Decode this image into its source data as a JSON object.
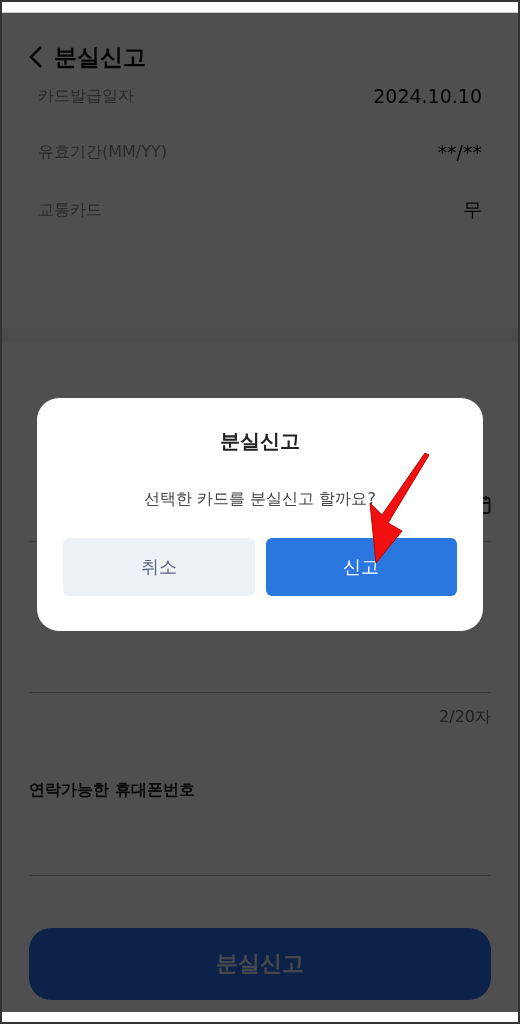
{
  "header": {
    "title": "분실신고"
  },
  "card_info": [
    {
      "label": "카드발급일자",
      "value": "2024.10.10"
    },
    {
      "label": "유효기간(MM/YY)",
      "value": "**/**"
    },
    {
      "label": "교통카드",
      "value": "무"
    }
  ],
  "form": {
    "memo_counter": "2/20자",
    "phone_label": "연락가능한 휴대폰번호",
    "submit_button": "분실신고"
  },
  "dialog": {
    "title": "분실신고",
    "message": "선택한 카드를 분실신고 할까요?",
    "buttons": [
      {
        "label": "취소",
        "kind": "secondary"
      },
      {
        "label": "신고",
        "kind": "primary"
      }
    ]
  }
}
